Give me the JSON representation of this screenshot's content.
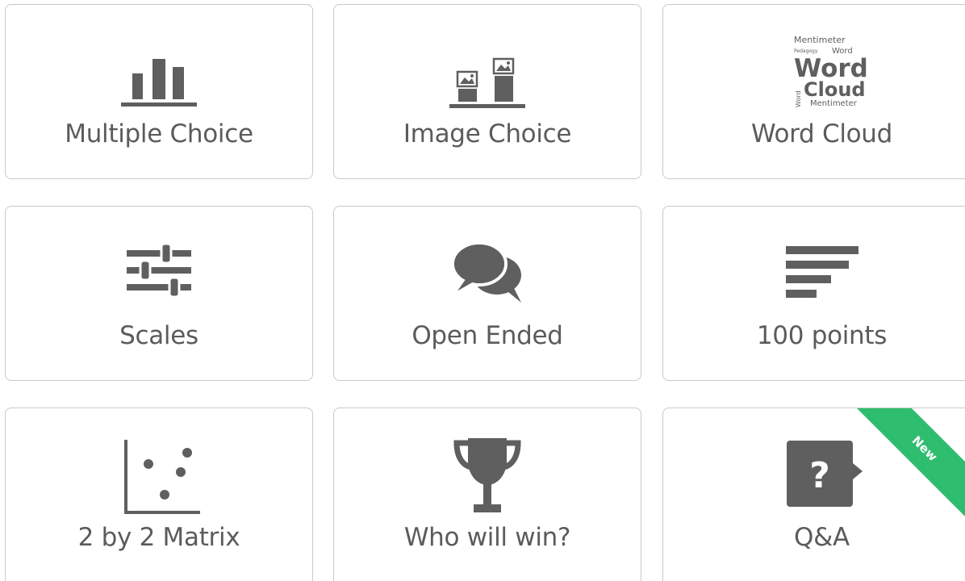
{
  "question_types": [
    {
      "label": "Multiple Choice",
      "icon": "bar-chart-icon"
    },
    {
      "label": "Image Choice",
      "icon": "image-choice-icon"
    },
    {
      "label": "Word Cloud",
      "icon": "word-cloud-icon"
    },
    {
      "label": "Scales",
      "icon": "sliders-icon"
    },
    {
      "label": "Open Ended",
      "icon": "speech-bubbles-icon"
    },
    {
      "label": "100 points",
      "icon": "horizontal-bars-icon"
    },
    {
      "label": "2 by 2 Matrix",
      "icon": "scatter-plot-icon"
    },
    {
      "label": "Who will win?",
      "icon": "trophy-icon"
    },
    {
      "label": "Q&A",
      "icon": "question-bubble-icon",
      "badge": "New"
    }
  ],
  "word_cloud_icon_text": {
    "line1": "Mentimeter",
    "line2a": "Pedagogy",
    "line2b": "Word",
    "big1": "Word",
    "big2": "Cloud",
    "side": "Word",
    "bottom": "Mentimeter"
  },
  "colors": {
    "icon": "#5f5f5f",
    "label": "#5b5b5b",
    "border": "#c9c9c9",
    "badge": "#2ebd6e"
  }
}
